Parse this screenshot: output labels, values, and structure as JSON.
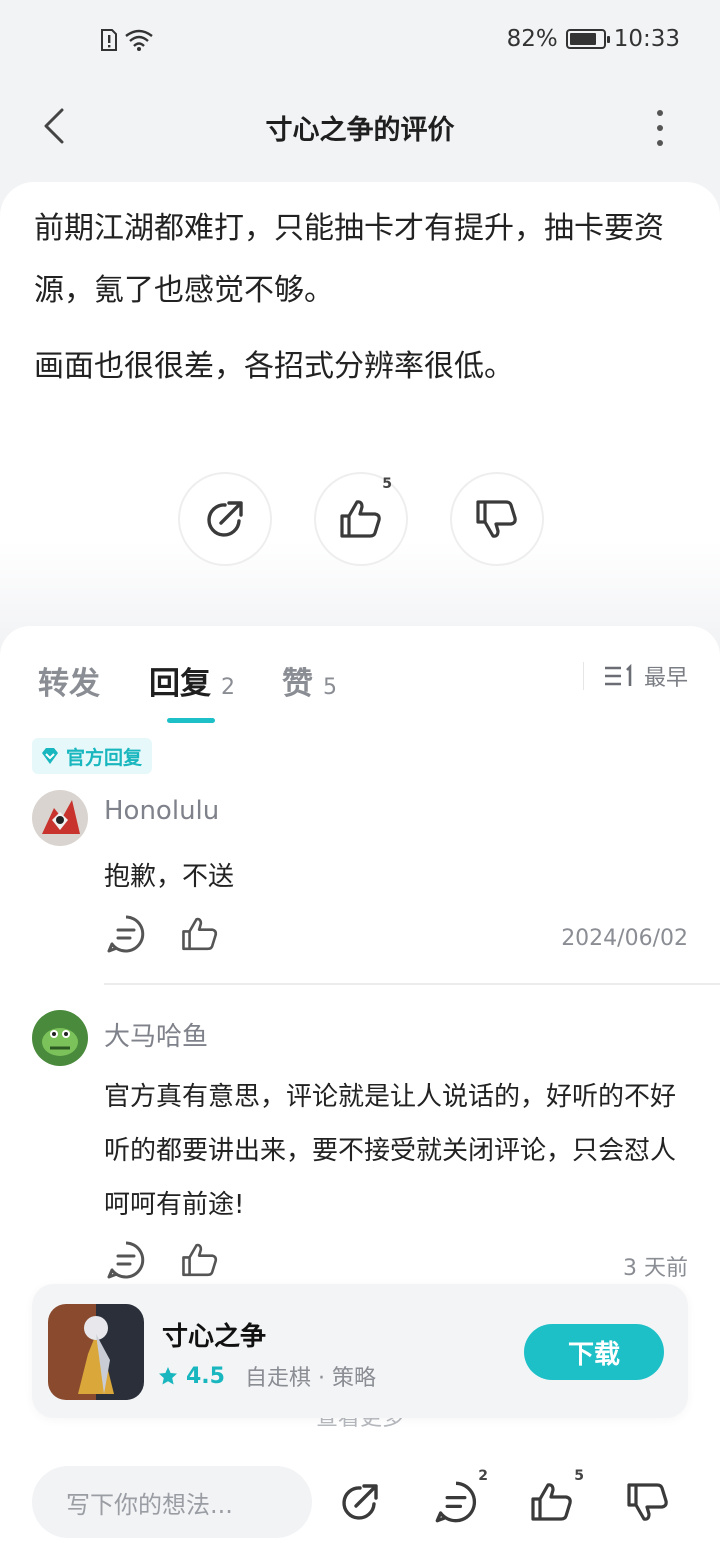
{
  "status_bar": {
    "battery": "82%",
    "battery_level": 0.82,
    "time": "10:33"
  },
  "header": {
    "title": "寸心之争的评价"
  },
  "review": {
    "paragraphs": [
      "前期江湖都难打，只能抽卡才有提升，抽卡要资源，氪了也感觉不够。",
      "画面也很很差，各招式分辨率很低。"
    ],
    "like_count": "5"
  },
  "tabs": [
    {
      "label": "转发",
      "count": ""
    },
    {
      "label": "回复",
      "count": "2"
    },
    {
      "label": "赞",
      "count": "5"
    }
  ],
  "sort": {
    "label": "最早"
  },
  "official_badge": "官方回复",
  "comments": [
    {
      "name": "Honolulu",
      "text": "抱歉，不送",
      "date": "2024/06/02"
    },
    {
      "name": "大马哈鱼",
      "text": "官方真有意思，评论就是让人说话的，好听的不好听的都要讲出来，要不接受就关闭评论，只会怼人呵呵有前途!",
      "date": "3 天前"
    }
  ],
  "see_more": "查看更多",
  "app": {
    "name": "寸心之争",
    "rating": "4.5",
    "tags": "自走棋 · 策略",
    "download_label": "下载"
  },
  "bottom_bar": {
    "placeholder": "写下你的想法...",
    "comment_count": "2",
    "like_count": "5"
  },
  "colors": {
    "accent": "#1ec0c8",
    "background": "#f2f3f5"
  }
}
